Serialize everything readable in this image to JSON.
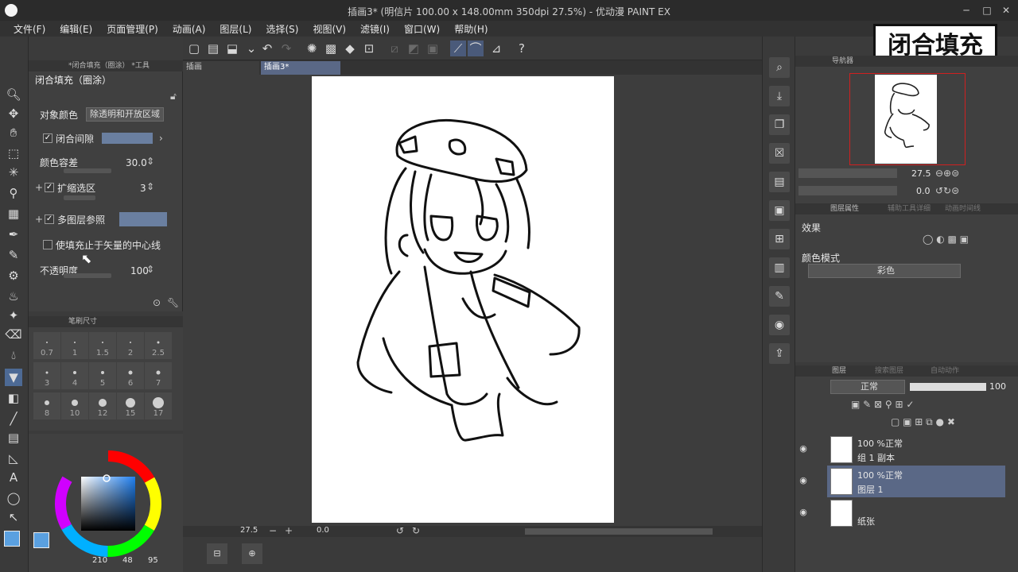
{
  "window": {
    "title": "插画3* (明信片 100.00 x 148.00mm 350dpi 27.5%) - 优动漫 PAINT EX",
    "minimize": "─",
    "maximize": "□",
    "close": "✕"
  },
  "menu": [
    "文件(F)",
    "编辑(E)",
    "页面管理(P)",
    "动画(A)",
    "图层(L)",
    "选择(S)",
    "视图(V)",
    "滤镜(I)",
    "窗口(W)",
    "帮助(H)"
  ],
  "caption": "闭合填充",
  "tool_property": {
    "tab_label": "*闭合填充（圈涂） *工具",
    "header": "闭合填充（圈涂）",
    "target_color_label": "对象颜色",
    "target_color_value": "除透明和开放区域",
    "close_gap_label": "闭合间隙",
    "close_gap_checked": true,
    "tolerance_label": "颜色容差",
    "tolerance_value": "30.0",
    "expand_label": "扩缩选区",
    "expand_checked": true,
    "expand_value": "3",
    "multilayer_label": "多图层参照",
    "multilayer_checked": true,
    "vector_center_label": "使填充止于矢量的中心线",
    "vector_center_checked": false,
    "opacity_label": "不透明度",
    "opacity_value": "100"
  },
  "brush_size": {
    "tab_label": "笔刷尺寸",
    "sizes": [
      "0.7",
      "1",
      "1.5",
      "2",
      "2.5",
      "3",
      "4",
      "5",
      "6",
      "7",
      "8",
      "10",
      "12",
      "15",
      "17"
    ]
  },
  "color": {
    "main": "#5aa0e0",
    "sub": "#ffffff",
    "readout_h": "210",
    "readout_s": "48",
    "readout_v": "95"
  },
  "doc_tabs": [
    "插画",
    "插画3*"
  ],
  "status": {
    "zoom": "27.5",
    "rotation": "0.0"
  },
  "navigator": {
    "tab_label": "导航器",
    "zoom": "27.5",
    "rotation": "0.0"
  },
  "layer_property": {
    "tab_labels": [
      "图层属性",
      "辅助工具详细",
      "动画时间线"
    ],
    "effect_label": "效果",
    "color_mode_label": "颜色模式",
    "color_mode_value": "彩色"
  },
  "layers": {
    "tab_labels": [
      "图层",
      "搜索图层",
      "自动动作"
    ],
    "blend_mode": "正常",
    "opacity": "100",
    "items": [
      {
        "percent": "100 %正常",
        "name": "组 1 副本"
      },
      {
        "percent": "100 %正常",
        "name": "图层 1"
      },
      {
        "percent": "",
        "name": "纸张"
      }
    ]
  }
}
